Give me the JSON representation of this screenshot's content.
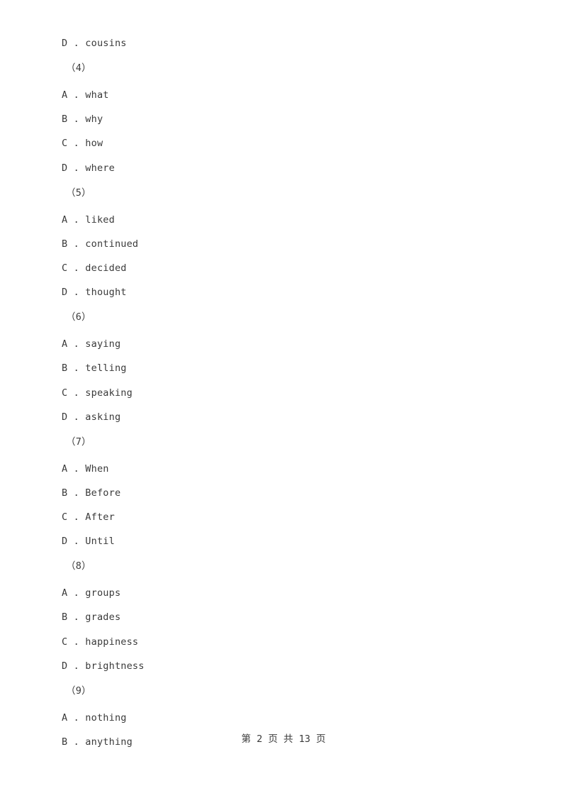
{
  "document": {
    "background_color": "#ffffff",
    "text_color": "#3a3a3a",
    "leading_option": "D . cousins",
    "question_groups": [
      {
        "number_label": "（4）",
        "options": [
          "A . what",
          "B . why",
          "C . how",
          "D . where"
        ]
      },
      {
        "number_label": "（5）",
        "options": [
          "A . liked",
          "B . continued",
          "C . decided",
          "D . thought"
        ]
      },
      {
        "number_label": "（6）",
        "options": [
          "A . saying",
          "B . telling",
          "C . speaking",
          "D . asking"
        ]
      },
      {
        "number_label": "（7）",
        "options": [
          "A . When",
          "B . Before",
          "C . After",
          "D . Until"
        ]
      },
      {
        "number_label": "（8）",
        "options": [
          "A . groups",
          "B . grades",
          "C . happiness",
          "D . brightness"
        ]
      },
      {
        "number_label": "（9）",
        "options": [
          "A . nothing",
          "B . anything"
        ]
      }
    ]
  },
  "footer": {
    "page_indicator": "第 2 页 共 13 页",
    "current_page": "2",
    "total_pages": "13"
  }
}
